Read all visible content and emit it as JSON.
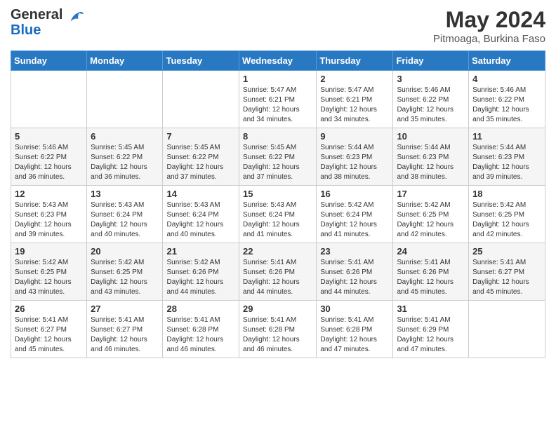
{
  "header": {
    "logo_general": "General",
    "logo_blue": "Blue",
    "month": "May 2024",
    "location": "Pitmoaga, Burkina Faso"
  },
  "days_of_week": [
    "Sunday",
    "Monday",
    "Tuesday",
    "Wednesday",
    "Thursday",
    "Friday",
    "Saturday"
  ],
  "weeks": [
    [
      {
        "day": "",
        "info": ""
      },
      {
        "day": "",
        "info": ""
      },
      {
        "day": "",
        "info": ""
      },
      {
        "day": "1",
        "info": "Sunrise: 5:47 AM\nSunset: 6:21 PM\nDaylight: 12 hours and 34 minutes."
      },
      {
        "day": "2",
        "info": "Sunrise: 5:47 AM\nSunset: 6:21 PM\nDaylight: 12 hours and 34 minutes."
      },
      {
        "day": "3",
        "info": "Sunrise: 5:46 AM\nSunset: 6:22 PM\nDaylight: 12 hours and 35 minutes."
      },
      {
        "day": "4",
        "info": "Sunrise: 5:46 AM\nSunset: 6:22 PM\nDaylight: 12 hours and 35 minutes."
      }
    ],
    [
      {
        "day": "5",
        "info": "Sunrise: 5:46 AM\nSunset: 6:22 PM\nDaylight: 12 hours and 36 minutes."
      },
      {
        "day": "6",
        "info": "Sunrise: 5:45 AM\nSunset: 6:22 PM\nDaylight: 12 hours and 36 minutes."
      },
      {
        "day": "7",
        "info": "Sunrise: 5:45 AM\nSunset: 6:22 PM\nDaylight: 12 hours and 37 minutes."
      },
      {
        "day": "8",
        "info": "Sunrise: 5:45 AM\nSunset: 6:22 PM\nDaylight: 12 hours and 37 minutes."
      },
      {
        "day": "9",
        "info": "Sunrise: 5:44 AM\nSunset: 6:23 PM\nDaylight: 12 hours and 38 minutes."
      },
      {
        "day": "10",
        "info": "Sunrise: 5:44 AM\nSunset: 6:23 PM\nDaylight: 12 hours and 38 minutes."
      },
      {
        "day": "11",
        "info": "Sunrise: 5:44 AM\nSunset: 6:23 PM\nDaylight: 12 hours and 39 minutes."
      }
    ],
    [
      {
        "day": "12",
        "info": "Sunrise: 5:43 AM\nSunset: 6:23 PM\nDaylight: 12 hours and 39 minutes."
      },
      {
        "day": "13",
        "info": "Sunrise: 5:43 AM\nSunset: 6:24 PM\nDaylight: 12 hours and 40 minutes."
      },
      {
        "day": "14",
        "info": "Sunrise: 5:43 AM\nSunset: 6:24 PM\nDaylight: 12 hours and 40 minutes."
      },
      {
        "day": "15",
        "info": "Sunrise: 5:43 AM\nSunset: 6:24 PM\nDaylight: 12 hours and 41 minutes."
      },
      {
        "day": "16",
        "info": "Sunrise: 5:42 AM\nSunset: 6:24 PM\nDaylight: 12 hours and 41 minutes."
      },
      {
        "day": "17",
        "info": "Sunrise: 5:42 AM\nSunset: 6:25 PM\nDaylight: 12 hours and 42 minutes."
      },
      {
        "day": "18",
        "info": "Sunrise: 5:42 AM\nSunset: 6:25 PM\nDaylight: 12 hours and 42 minutes."
      }
    ],
    [
      {
        "day": "19",
        "info": "Sunrise: 5:42 AM\nSunset: 6:25 PM\nDaylight: 12 hours and 43 minutes."
      },
      {
        "day": "20",
        "info": "Sunrise: 5:42 AM\nSunset: 6:25 PM\nDaylight: 12 hours and 43 minutes."
      },
      {
        "day": "21",
        "info": "Sunrise: 5:42 AM\nSunset: 6:26 PM\nDaylight: 12 hours and 44 minutes."
      },
      {
        "day": "22",
        "info": "Sunrise: 5:41 AM\nSunset: 6:26 PM\nDaylight: 12 hours and 44 minutes."
      },
      {
        "day": "23",
        "info": "Sunrise: 5:41 AM\nSunset: 6:26 PM\nDaylight: 12 hours and 44 minutes."
      },
      {
        "day": "24",
        "info": "Sunrise: 5:41 AM\nSunset: 6:26 PM\nDaylight: 12 hours and 45 minutes."
      },
      {
        "day": "25",
        "info": "Sunrise: 5:41 AM\nSunset: 6:27 PM\nDaylight: 12 hours and 45 minutes."
      }
    ],
    [
      {
        "day": "26",
        "info": "Sunrise: 5:41 AM\nSunset: 6:27 PM\nDaylight: 12 hours and 45 minutes."
      },
      {
        "day": "27",
        "info": "Sunrise: 5:41 AM\nSunset: 6:27 PM\nDaylight: 12 hours and 46 minutes."
      },
      {
        "day": "28",
        "info": "Sunrise: 5:41 AM\nSunset: 6:28 PM\nDaylight: 12 hours and 46 minutes."
      },
      {
        "day": "29",
        "info": "Sunrise: 5:41 AM\nSunset: 6:28 PM\nDaylight: 12 hours and 46 minutes."
      },
      {
        "day": "30",
        "info": "Sunrise: 5:41 AM\nSunset: 6:28 PM\nDaylight: 12 hours and 47 minutes."
      },
      {
        "day": "31",
        "info": "Sunrise: 5:41 AM\nSunset: 6:29 PM\nDaylight: 12 hours and 47 minutes."
      },
      {
        "day": "",
        "info": ""
      }
    ]
  ]
}
